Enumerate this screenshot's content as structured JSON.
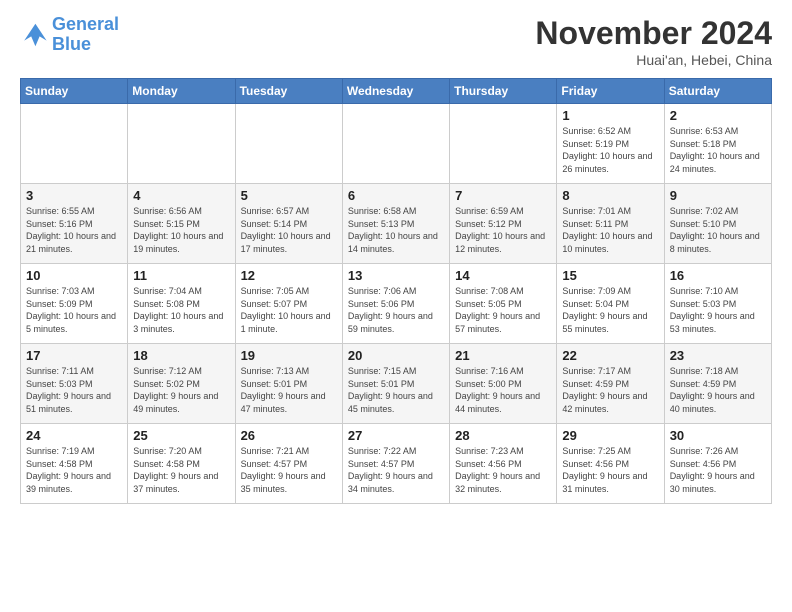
{
  "header": {
    "logo_line1": "General",
    "logo_line2": "Blue",
    "month": "November 2024",
    "location": "Huai'an, Hebei, China"
  },
  "weekdays": [
    "Sunday",
    "Monday",
    "Tuesday",
    "Wednesday",
    "Thursday",
    "Friday",
    "Saturday"
  ],
  "weeks": [
    [
      {
        "day": "",
        "info": ""
      },
      {
        "day": "",
        "info": ""
      },
      {
        "day": "",
        "info": ""
      },
      {
        "day": "",
        "info": ""
      },
      {
        "day": "",
        "info": ""
      },
      {
        "day": "1",
        "info": "Sunrise: 6:52 AM\nSunset: 5:19 PM\nDaylight: 10 hours and 26 minutes."
      },
      {
        "day": "2",
        "info": "Sunrise: 6:53 AM\nSunset: 5:18 PM\nDaylight: 10 hours and 24 minutes."
      }
    ],
    [
      {
        "day": "3",
        "info": "Sunrise: 6:55 AM\nSunset: 5:16 PM\nDaylight: 10 hours and 21 minutes."
      },
      {
        "day": "4",
        "info": "Sunrise: 6:56 AM\nSunset: 5:15 PM\nDaylight: 10 hours and 19 minutes."
      },
      {
        "day": "5",
        "info": "Sunrise: 6:57 AM\nSunset: 5:14 PM\nDaylight: 10 hours and 17 minutes."
      },
      {
        "day": "6",
        "info": "Sunrise: 6:58 AM\nSunset: 5:13 PM\nDaylight: 10 hours and 14 minutes."
      },
      {
        "day": "7",
        "info": "Sunrise: 6:59 AM\nSunset: 5:12 PM\nDaylight: 10 hours and 12 minutes."
      },
      {
        "day": "8",
        "info": "Sunrise: 7:01 AM\nSunset: 5:11 PM\nDaylight: 10 hours and 10 minutes."
      },
      {
        "day": "9",
        "info": "Sunrise: 7:02 AM\nSunset: 5:10 PM\nDaylight: 10 hours and 8 minutes."
      }
    ],
    [
      {
        "day": "10",
        "info": "Sunrise: 7:03 AM\nSunset: 5:09 PM\nDaylight: 10 hours and 5 minutes."
      },
      {
        "day": "11",
        "info": "Sunrise: 7:04 AM\nSunset: 5:08 PM\nDaylight: 10 hours and 3 minutes."
      },
      {
        "day": "12",
        "info": "Sunrise: 7:05 AM\nSunset: 5:07 PM\nDaylight: 10 hours and 1 minute."
      },
      {
        "day": "13",
        "info": "Sunrise: 7:06 AM\nSunset: 5:06 PM\nDaylight: 9 hours and 59 minutes."
      },
      {
        "day": "14",
        "info": "Sunrise: 7:08 AM\nSunset: 5:05 PM\nDaylight: 9 hours and 57 minutes."
      },
      {
        "day": "15",
        "info": "Sunrise: 7:09 AM\nSunset: 5:04 PM\nDaylight: 9 hours and 55 minutes."
      },
      {
        "day": "16",
        "info": "Sunrise: 7:10 AM\nSunset: 5:03 PM\nDaylight: 9 hours and 53 minutes."
      }
    ],
    [
      {
        "day": "17",
        "info": "Sunrise: 7:11 AM\nSunset: 5:03 PM\nDaylight: 9 hours and 51 minutes."
      },
      {
        "day": "18",
        "info": "Sunrise: 7:12 AM\nSunset: 5:02 PM\nDaylight: 9 hours and 49 minutes."
      },
      {
        "day": "19",
        "info": "Sunrise: 7:13 AM\nSunset: 5:01 PM\nDaylight: 9 hours and 47 minutes."
      },
      {
        "day": "20",
        "info": "Sunrise: 7:15 AM\nSunset: 5:01 PM\nDaylight: 9 hours and 45 minutes."
      },
      {
        "day": "21",
        "info": "Sunrise: 7:16 AM\nSunset: 5:00 PM\nDaylight: 9 hours and 44 minutes."
      },
      {
        "day": "22",
        "info": "Sunrise: 7:17 AM\nSunset: 4:59 PM\nDaylight: 9 hours and 42 minutes."
      },
      {
        "day": "23",
        "info": "Sunrise: 7:18 AM\nSunset: 4:59 PM\nDaylight: 9 hours and 40 minutes."
      }
    ],
    [
      {
        "day": "24",
        "info": "Sunrise: 7:19 AM\nSunset: 4:58 PM\nDaylight: 9 hours and 39 minutes."
      },
      {
        "day": "25",
        "info": "Sunrise: 7:20 AM\nSunset: 4:58 PM\nDaylight: 9 hours and 37 minutes."
      },
      {
        "day": "26",
        "info": "Sunrise: 7:21 AM\nSunset: 4:57 PM\nDaylight: 9 hours and 35 minutes."
      },
      {
        "day": "27",
        "info": "Sunrise: 7:22 AM\nSunset: 4:57 PM\nDaylight: 9 hours and 34 minutes."
      },
      {
        "day": "28",
        "info": "Sunrise: 7:23 AM\nSunset: 4:56 PM\nDaylight: 9 hours and 32 minutes."
      },
      {
        "day": "29",
        "info": "Sunrise: 7:25 AM\nSunset: 4:56 PM\nDaylight: 9 hours and 31 minutes."
      },
      {
        "day": "30",
        "info": "Sunrise: 7:26 AM\nSunset: 4:56 PM\nDaylight: 9 hours and 30 minutes."
      }
    ]
  ]
}
